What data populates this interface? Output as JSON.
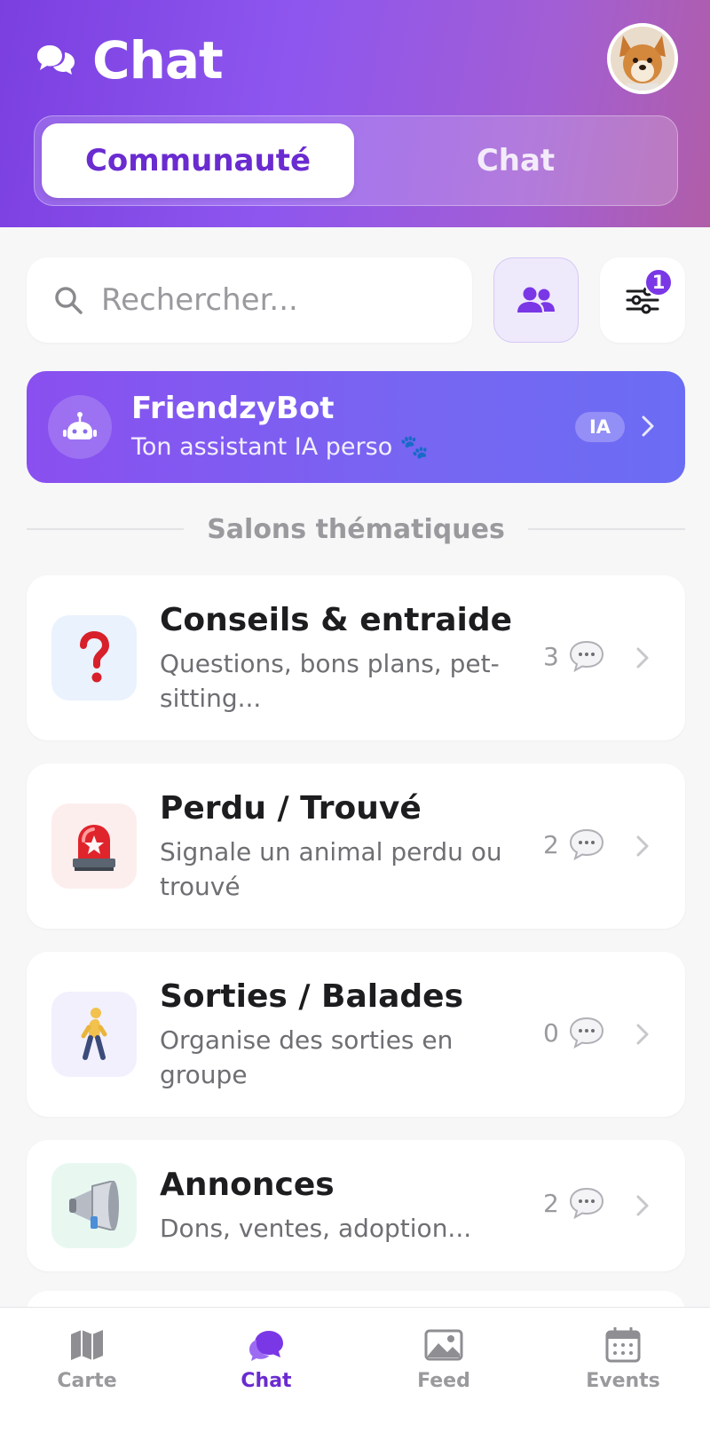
{
  "header": {
    "title": "Chat",
    "avatar_alt": "Profile photo"
  },
  "segmented": {
    "options": [
      {
        "label": "Communauté",
        "active": true
      },
      {
        "label": "Chat",
        "active": false
      }
    ]
  },
  "search": {
    "placeholder": "Rechercher...",
    "value": ""
  },
  "filter": {
    "badge": "1"
  },
  "bot": {
    "name": "FriendzyBot",
    "subtitle": "Ton assistant IA perso",
    "badge": "IA"
  },
  "section": {
    "title": "Salons thématiques"
  },
  "rooms": [
    {
      "title": "Conseils & entraide",
      "description": "Questions, bons plans, pet-sitting...",
      "count": "3",
      "icon": "question-mark-icon",
      "icon_bg": "#eaf2fd"
    },
    {
      "title": "Perdu / Trouvé",
      "description": "Signale un animal perdu ou trouvé",
      "count": "2",
      "icon": "siren-icon",
      "icon_bg": "#fdeeee"
    },
    {
      "title": "Sorties / Balades",
      "description": "Organise des sorties en groupe",
      "count": "0",
      "icon": "walking-person-icon",
      "icon_bg": "#f2f0fd"
    },
    {
      "title": "Annonces",
      "description": "Dons, ventes, adoption...",
      "count": "2",
      "icon": "megaphone-icon",
      "icon_bg": "#e8f8f1"
    }
  ],
  "tabbar": {
    "tabs": [
      {
        "label": "Carte",
        "active": false
      },
      {
        "label": "Chat",
        "active": true
      },
      {
        "label": "Feed",
        "active": false
      },
      {
        "label": "Events",
        "active": false
      }
    ]
  },
  "colors": {
    "accent": "#6a2bd0",
    "header_gradient_start": "#7b3fe0",
    "header_gradient_end": "#b15ea8",
    "bot_gradient_start": "#8a4ff0",
    "bot_gradient_end": "#6b6cf4"
  }
}
